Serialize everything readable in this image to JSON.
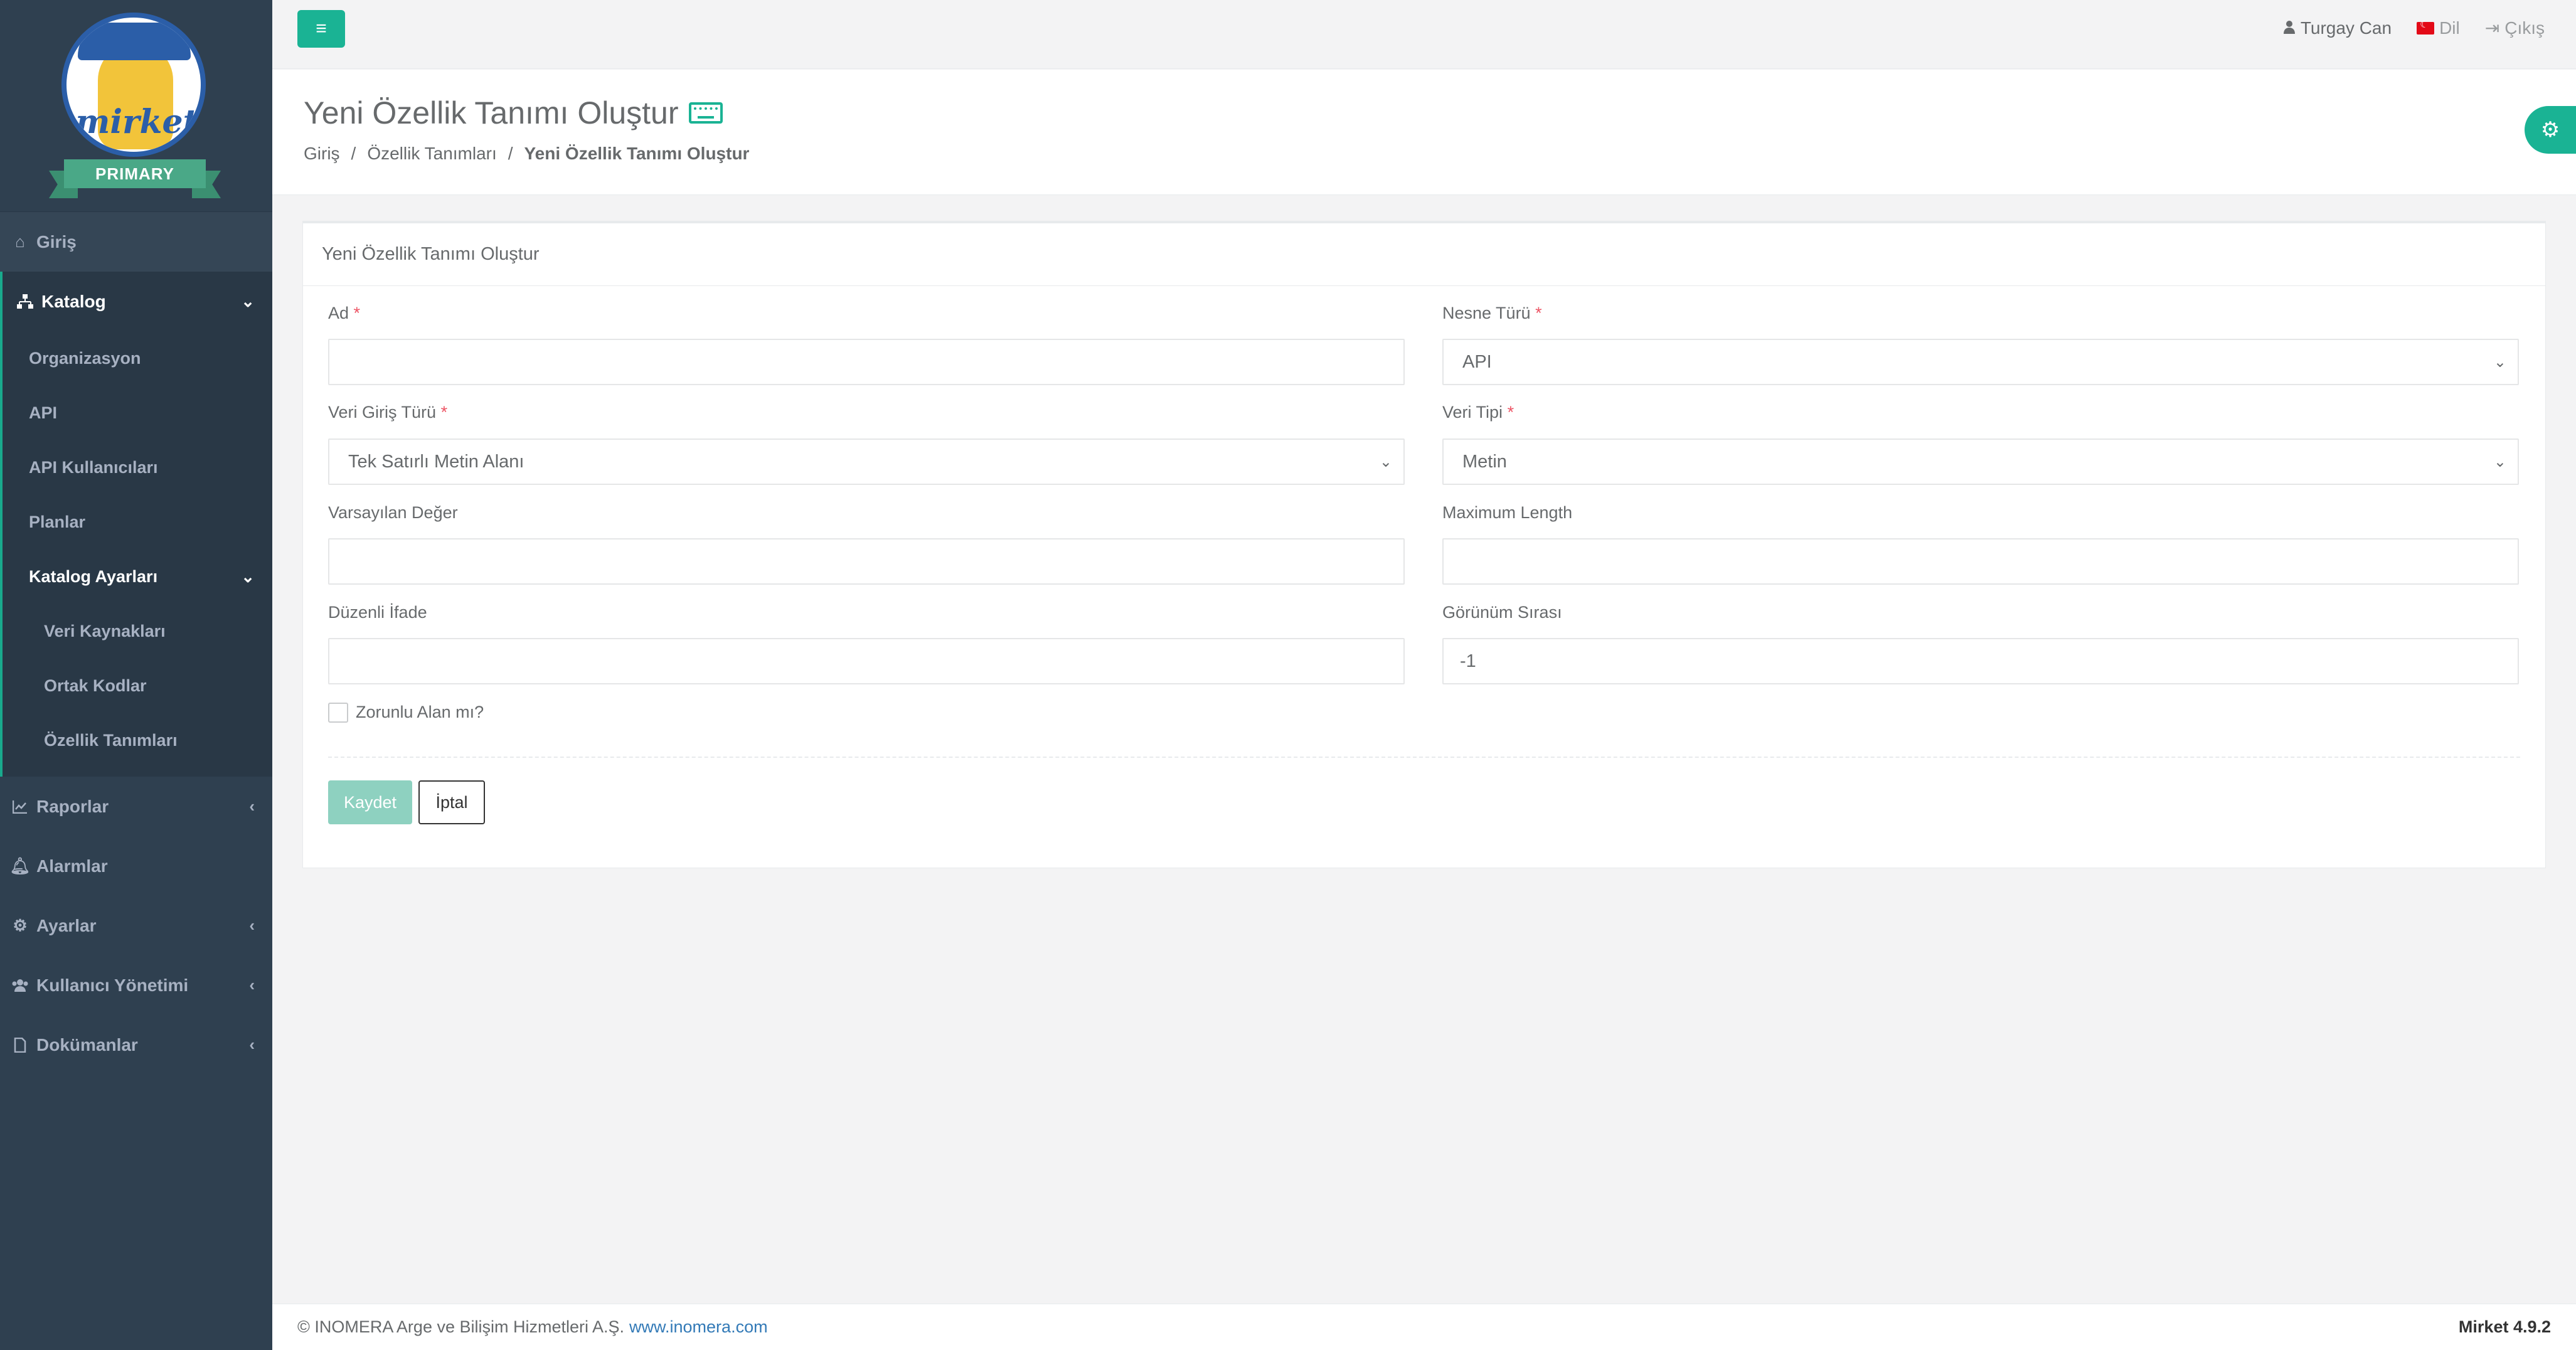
{
  "brand": {
    "logo_word": "mirket",
    "ribbon": "PRIMARY"
  },
  "sidebar": {
    "home": "Giriş",
    "catalog": "Katalog",
    "catalog_items": [
      "Organizasyon",
      "API",
      "API Kullanıcıları",
      "Planlar"
    ],
    "catalog_settings": "Katalog Ayarları",
    "catalog_settings_items": [
      "Veri Kaynakları",
      "Ortak Kodlar",
      "Özellik Tanımları"
    ],
    "reports": "Raporlar",
    "alarms": "Alarmlar",
    "settings": "Ayarlar",
    "user_management": "Kullanıcı Yönetimi",
    "documents": "Dokümanlar"
  },
  "topbar": {
    "menu_icon": "≡",
    "user": "Turgay Can",
    "language": "Dil",
    "logout": "Çıkış"
  },
  "page": {
    "title": "Yeni Özellik Tanımı Oluştur",
    "breadcrumb": [
      "Giriş",
      "Özellik Tanımları",
      "Yeni Özellik Tanımı Oluştur"
    ]
  },
  "form": {
    "panel_title": "Yeni Özellik Tanımı Oluştur",
    "name_label": "Ad",
    "name_value": "",
    "object_type_label": "Nesne Türü",
    "object_type_value": "API",
    "input_type_label": "Veri Giriş Türü",
    "input_type_value": "Tek Satırlı Metin Alanı",
    "data_type_label": "Veri Tipi",
    "data_type_value": "Metin",
    "default_label": "Varsayılan Değer",
    "default_value": "",
    "maxlen_label": "Maximum Length",
    "maxlen_value": "",
    "regex_label": "Düzenli İfade",
    "regex_value": "",
    "order_label": "Görünüm Sırası",
    "order_value": "-1",
    "required_label": "Zorunlu Alan mı?",
    "required_mark": "*",
    "save": "Kaydet",
    "cancel": "İptal"
  },
  "footer": {
    "copyright": "© INOMERA Arge ve Bilişim Hizmetleri A.Ş.",
    "link": "www.inomera.com",
    "version": "Mirket 4.9.2"
  }
}
